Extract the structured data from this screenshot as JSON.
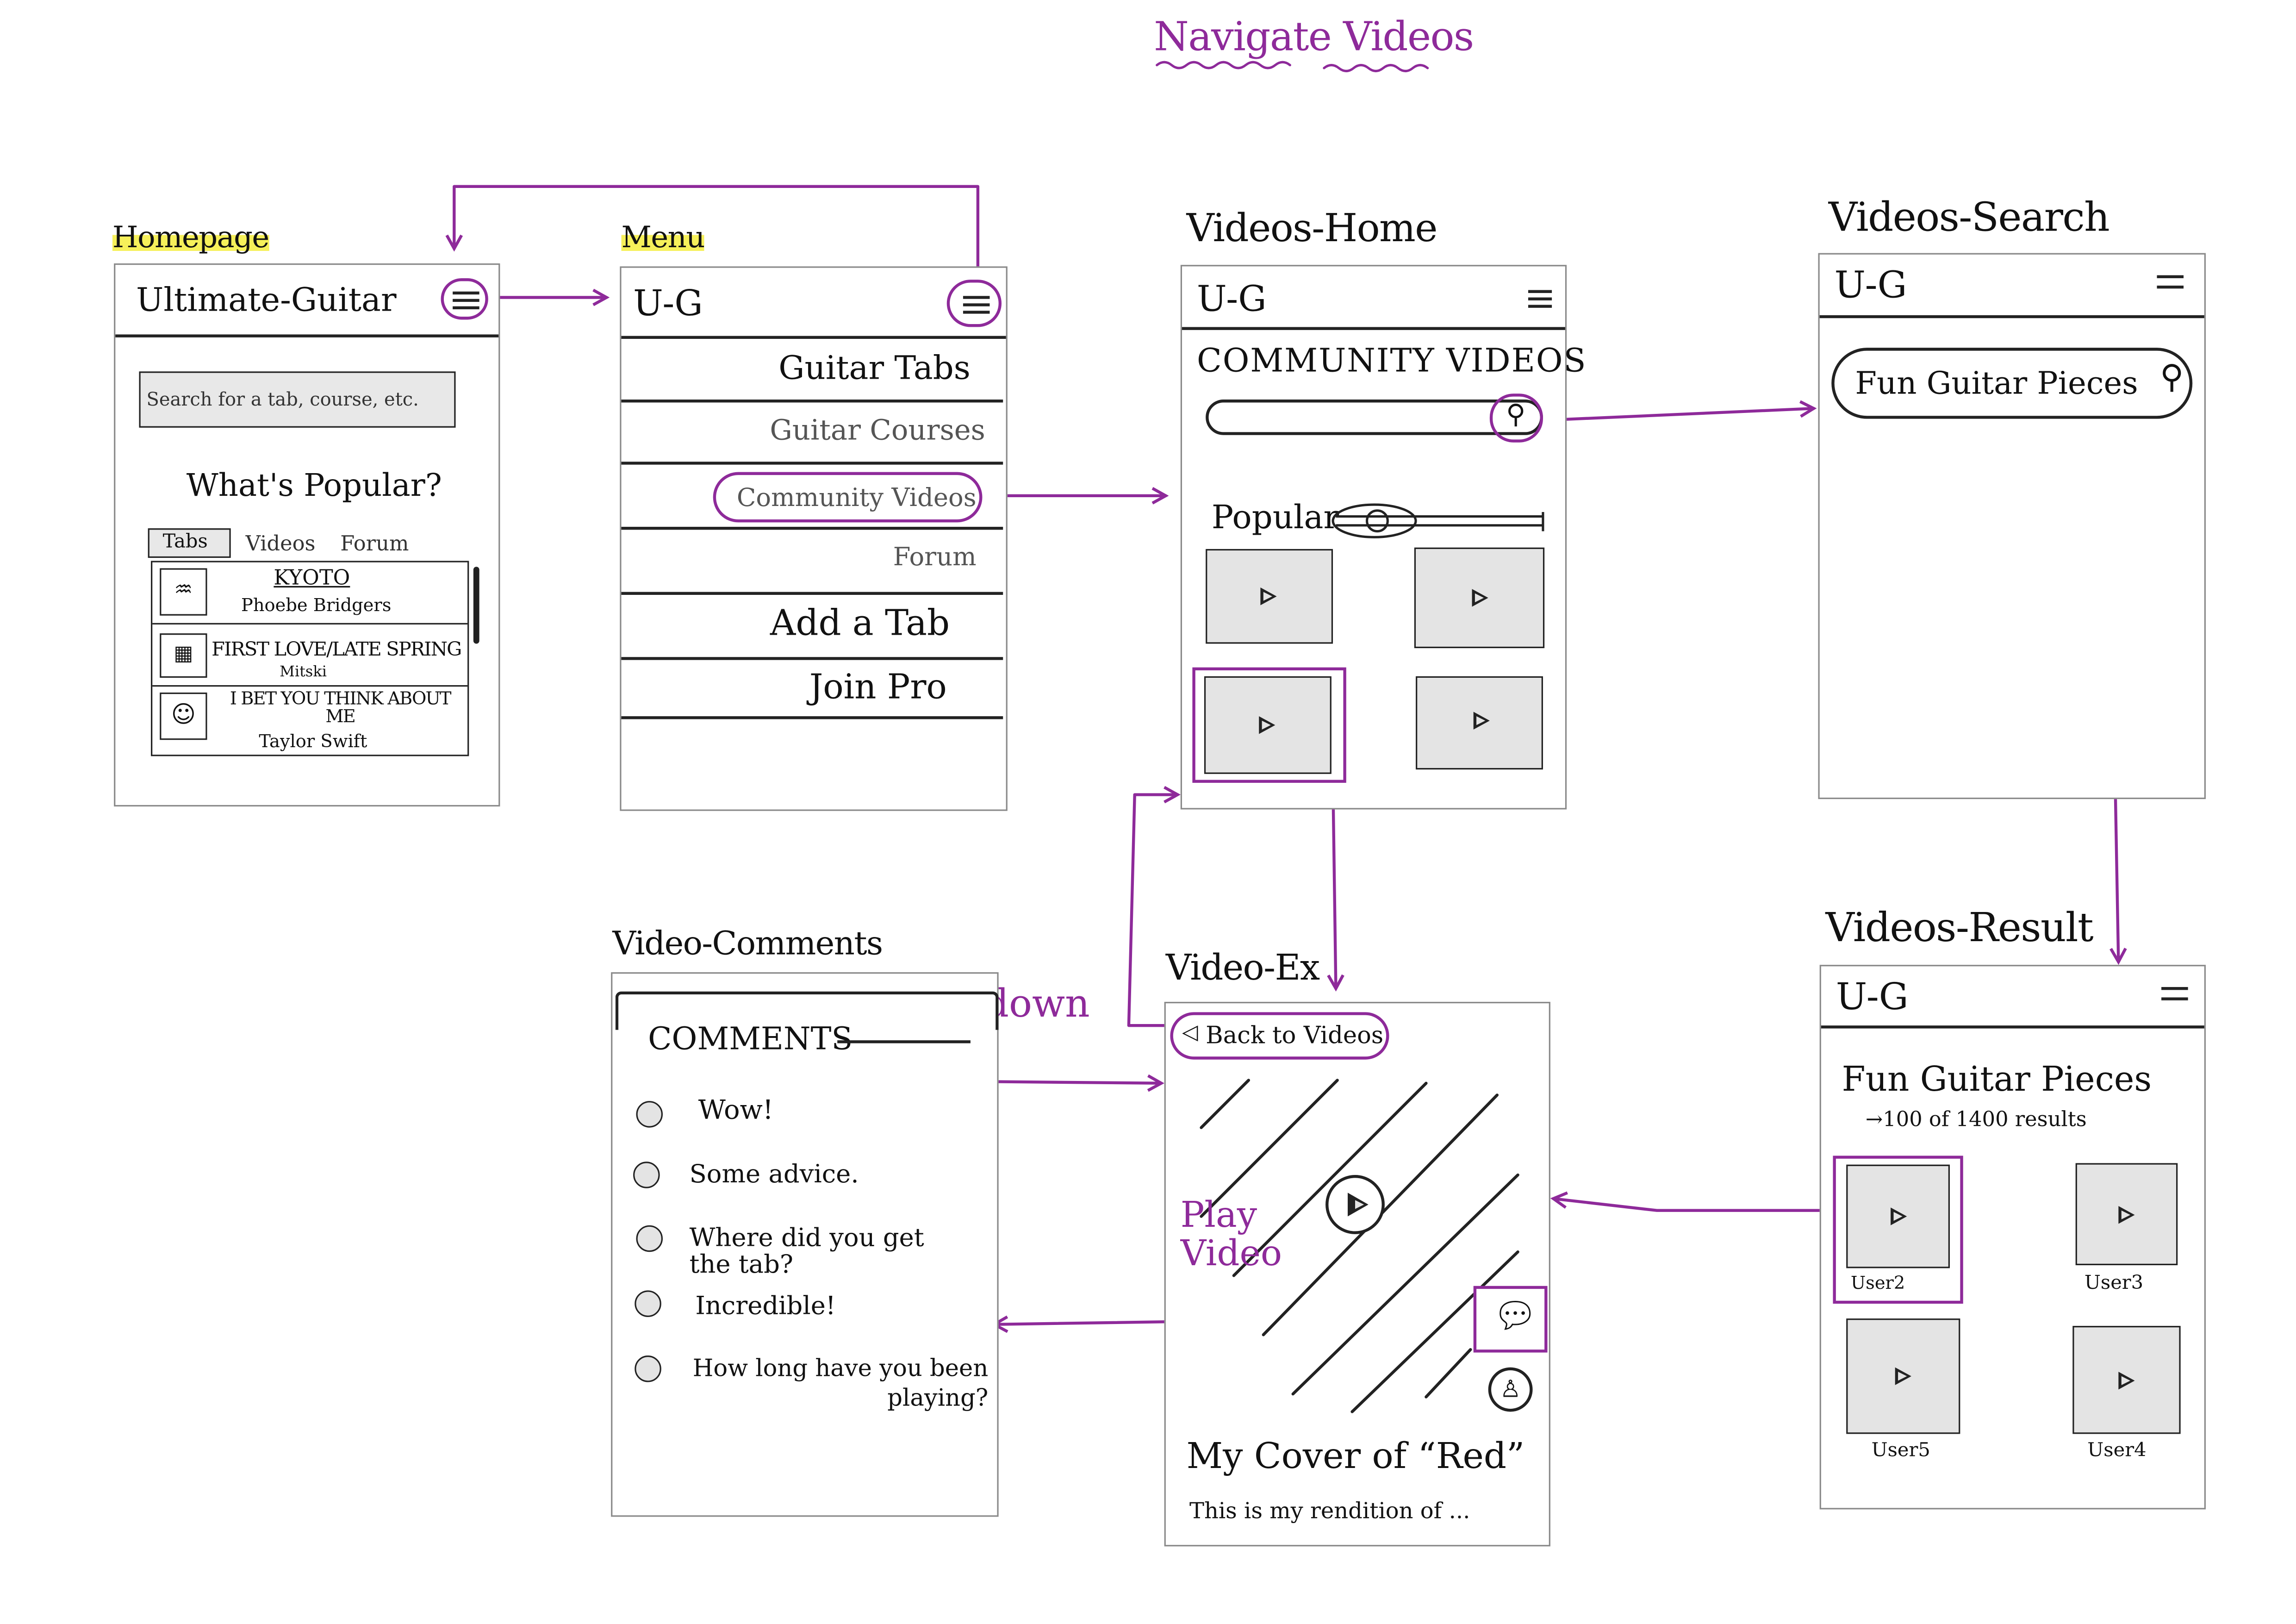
{
  "title": "Navigate Videos",
  "colors": {
    "flow": "#8e2a9a",
    "highlight": "#f6f05a",
    "placeholder_fill": "#e4e4e4",
    "ink": "#111111"
  },
  "icons": [
    "hamburger-menu-icon",
    "search-icon",
    "play-icon",
    "comment-icon",
    "profile-icon",
    "guitar-icon"
  ],
  "homepage": {
    "label": "Homepage",
    "brand": "Ultimate-Guitar",
    "search_placeholder": "Search for a tab, course, etc.",
    "section_title": "What's Popular?",
    "tabs": [
      "Tabs",
      "Videos",
      "Forum"
    ],
    "songs": [
      {
        "title": "KYOTO",
        "artist": "Phoebe Bridgers"
      },
      {
        "title": "FIRST LOVE/LATE SPRING",
        "artist": "Mitski"
      },
      {
        "title": "I BET YOU THINK ABOUT ME",
        "artist": "Taylor Swift"
      }
    ]
  },
  "menu": {
    "label": "Menu",
    "brand": "U-G",
    "items": [
      "Guitar Tabs",
      "Guitar Courses",
      "Community Videos",
      "Forum",
      "Add a Tab",
      "Join Pro"
    ]
  },
  "videos_home": {
    "label": "Videos-Home",
    "brand": "U-G",
    "heading": "COMMUNITY VIDEOS",
    "section": "Popular"
  },
  "videos_search": {
    "label": "Videos-Search",
    "brand": "U-G",
    "query": "Fun Guitar Pieces"
  },
  "videos_result": {
    "label": "Videos-Result",
    "brand": "U-G",
    "query": "Fun Guitar Pieces",
    "count": "→100 of 1400 results",
    "users": [
      "User2",
      "User3",
      "User5",
      "User4"
    ]
  },
  "video_ex": {
    "label": "Video-Ex",
    "back": "Back to Videos",
    "annotation": "Play Video",
    "video_title": "My Cover of “Red”",
    "description": "This is my rendition of ..."
  },
  "video_comments": {
    "label": "Video-Comments",
    "annotation": "Scroll down",
    "heading": "COMMENTS",
    "comments": [
      "Wow!",
      "Some advice.",
      "Where did you get the tab?",
      "Incredible!",
      "How long have you been playing?"
    ]
  }
}
